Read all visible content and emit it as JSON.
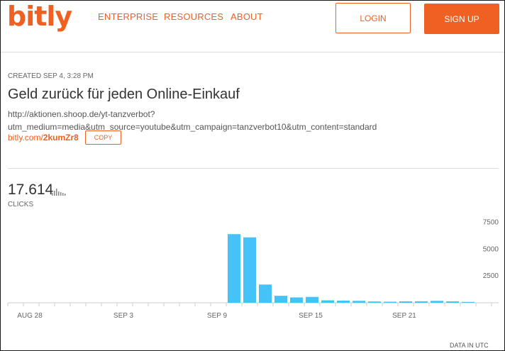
{
  "header": {
    "logo": "bitly",
    "nav": [
      "ENTERPRISE",
      "RESOURCES",
      "ABOUT"
    ],
    "login_label": "LOGIN",
    "signup_label": "SIGN UP"
  },
  "link": {
    "created": "CREATED SEP 4, 3:28 PM",
    "title": "Geld zurück für jeden Online-Einkauf",
    "url_line1": "http://aktionen.shoop.de/yt-tanzverbot?",
    "url_line2": "utm_medium=media&utm_source=youtube&utm_campaign=tanzverbot10&utm_content=standard",
    "short_domain": "bitly.com/",
    "short_code": "2kumZr8",
    "copy_label": "COPY"
  },
  "stats": {
    "total": "17.614",
    "label": "CLICKS",
    "chart_icon": "bar-chart-icon"
  },
  "footer_note": "DATA IN UTC",
  "colors": {
    "accent": "#ee6123",
    "bar": "#45c2f7"
  },
  "chart_data": {
    "type": "bar",
    "x_tick_labels": [
      "AUG 28",
      "SEP 3",
      "SEP 9",
      "SEP 15",
      "SEP 21"
    ],
    "y_tick_labels": [
      "7500",
      "5000",
      "2500"
    ],
    "ylim": [
      0,
      8000
    ],
    "categories": [
      "Aug 27",
      "Aug 28",
      "Aug 29",
      "Aug 30",
      "Aug 31",
      "Sep 1",
      "Sep 2",
      "Sep 3",
      "Sep 4",
      "Sep 5",
      "Sep 6",
      "Sep 7",
      "Sep 8",
      "Sep 9",
      "Sep 10",
      "Sep 11",
      "Sep 12",
      "Sep 13",
      "Sep 14",
      "Sep 15",
      "Sep 16",
      "Sep 17",
      "Sep 18",
      "Sep 19",
      "Sep 20",
      "Sep 21",
      "Sep 22",
      "Sep 23",
      "Sep 24",
      "Sep 25",
      "Sep 26"
    ],
    "values": [
      0,
      0,
      0,
      0,
      0,
      0,
      0,
      0,
      0,
      0,
      0,
      0,
      0,
      0,
      6400,
      6100,
      1700,
      650,
      500,
      550,
      230,
      200,
      180,
      120,
      100,
      130,
      140,
      180,
      130,
      80,
      0
    ]
  }
}
